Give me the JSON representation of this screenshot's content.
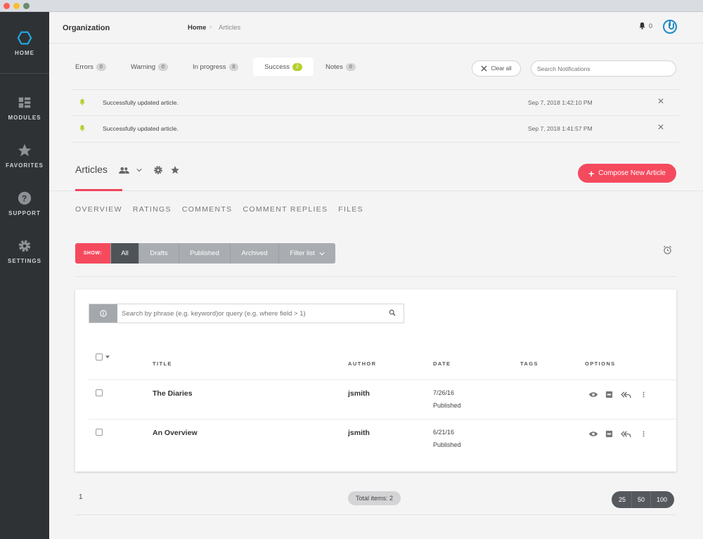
{
  "sidebar": {
    "items": [
      {
        "label": "HOME",
        "icon": "hexagon-icon"
      },
      {
        "label": "MODULES",
        "icon": "grid-icon"
      },
      {
        "label": "FAVORITES",
        "icon": "star-icon"
      },
      {
        "label": "SUPPORT",
        "icon": "question-icon"
      },
      {
        "label": "SETTINGS",
        "icon": "gear-icon"
      }
    ]
  },
  "header": {
    "org": "Organization",
    "breadcrumb": {
      "home": "Home",
      "sep": "›",
      "current": "Articles"
    },
    "bell_count": "0"
  },
  "notif_tabs": [
    {
      "label": "Errors",
      "count": "0"
    },
    {
      "label": "Warning",
      "count": "0"
    },
    {
      "label": "In progress",
      "count": "0"
    },
    {
      "label": "Success",
      "count": "2"
    },
    {
      "label": "Notes",
      "count": "0"
    }
  ],
  "notif_actions": {
    "clear_all": "Clear all",
    "search_placeholder": "Search Notifications"
  },
  "notifications": [
    {
      "message": "Successfully updated article.",
      "timestamp": "Sep 7, 2018 1:42:10 PM"
    },
    {
      "message": "Successfully updated article.",
      "timestamp": "Sep 7, 2018 1:41:57 PM"
    }
  ],
  "articles": {
    "title": "Articles",
    "compose_label": "Compose New Article",
    "compose_plus": "+",
    "subtabs": [
      "OVERVIEW",
      "RATINGS",
      "COMMENTS",
      "COMMENT REPLIES",
      "FILES"
    ]
  },
  "filter": {
    "show_label": "SHOW:",
    "buttons": [
      "All",
      "Drafts",
      "Published",
      "Archived",
      "Filter list"
    ]
  },
  "table": {
    "search_placeholder": "Search by phrase (e.g. keyword)or query (e.g. where field > 1)",
    "headers": [
      "TITLE",
      "AUTHOR",
      "DATE",
      "TAGS",
      "OPTIONS"
    ],
    "rows": [
      {
        "title": "The Diaries",
        "author": "jsmith",
        "date": "7/26/16",
        "status": "Published"
      },
      {
        "title": "An Overview",
        "author": "jsmith",
        "date": "6/21/16",
        "status": "Published"
      }
    ]
  },
  "footer": {
    "page": "1",
    "total": "Total items: 2",
    "page_sizes": [
      "25",
      "50",
      "100"
    ]
  },
  "colors": {
    "accent": "#f54a5e",
    "sidebar": "#2f3234",
    "success_badge": "#b5cf2d",
    "power": "#1d8ac4"
  }
}
